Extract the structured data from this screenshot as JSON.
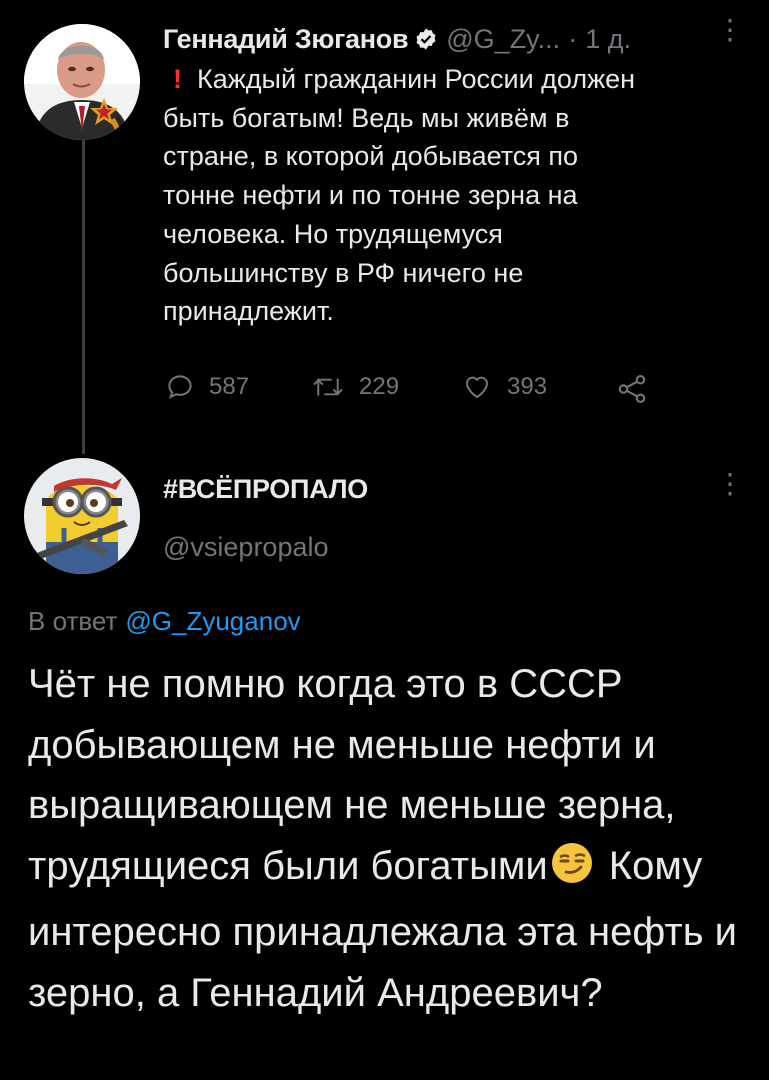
{
  "original_tweet": {
    "display_name": "Геннадий Зюганов",
    "handle": "@G_Zy...",
    "separator": "·",
    "time": "1 д.",
    "alert_symbol": "!",
    "text": "Каждый гражданин России должен\nбыть богатым! Ведь мы живём в\nстране, в которой добывается по\nтонне нефти и  по тонне зерна на\nчеловека. Но трудящемуся\nбольшинству в РФ ничего не\nпринадлежит.",
    "stats": {
      "replies": "587",
      "retweets": "229",
      "likes": "393"
    },
    "icons": [
      "verified-icon",
      "more-icon",
      "reply-icon",
      "retweet-icon",
      "like-icon",
      "share-icon"
    ]
  },
  "reply_tweet": {
    "display_name": "#ВСЁПРОПАЛО",
    "handle": "@vsiepropalo",
    "in_reply_label": "В ответ",
    "in_reply_mention": "@G_Zyuganov",
    "text_part1": "Чёт не помню когда это в СССР добывающем не меньше нефти и выращивающем не меньше зерна, трудящиеся были богатыми",
    "emoji": "smirking-face-emoji",
    "text_part2": " Кому интересно принадлежала эта нефть и зерно, а Геннадий Андреевич?"
  },
  "colors": {
    "background": "#000000",
    "text": "#e7e9ea",
    "secondary": "#71767b",
    "link": "#1d9bf0",
    "verified": "#e7e9ea",
    "alert": "#ff2d2d",
    "thread_line": "#3a3f44"
  }
}
